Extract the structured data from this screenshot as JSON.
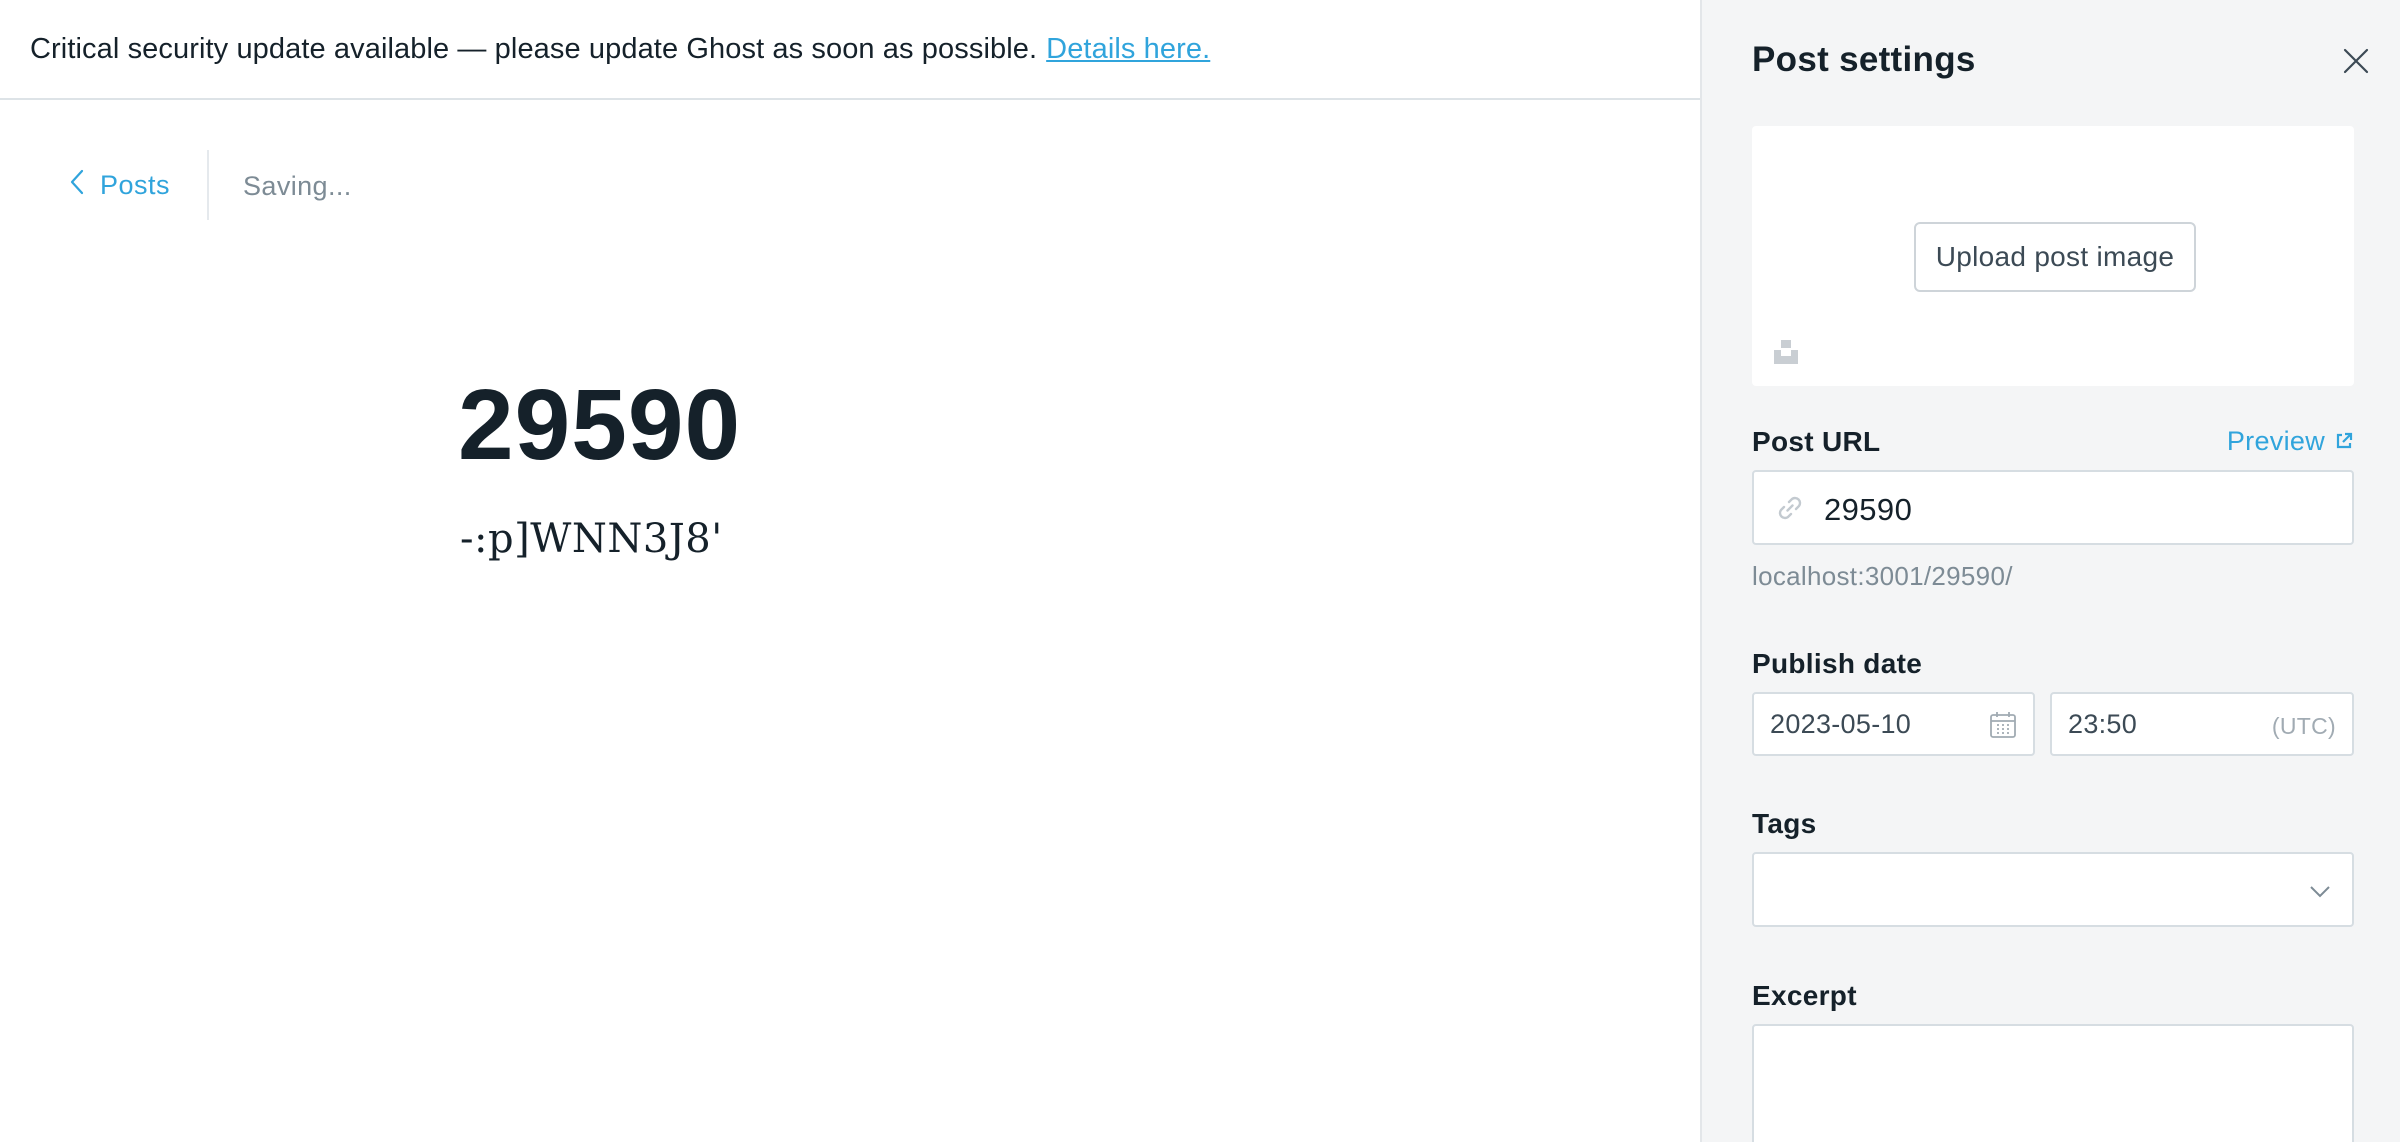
{
  "alert": {
    "message": "Critical security update available — please update Ghost as soon as possible.",
    "link_text": "Details here."
  },
  "editor_nav": {
    "back_label": "Posts",
    "status": "Saving..."
  },
  "post": {
    "title": "29590",
    "body": "-:p]WNN3J8'"
  },
  "settings": {
    "title": "Post settings",
    "upload_label": "Upload post image",
    "post_url": {
      "label": "Post URL",
      "preview_label": "Preview",
      "value": "29590",
      "hint": "localhost:3001/29590/"
    },
    "publish_date": {
      "label": "Publish date",
      "date": "2023-05-10",
      "time": "23:50",
      "timezone": "(UTC)"
    },
    "tags": {
      "label": "Tags",
      "value": ""
    },
    "excerpt": {
      "label": "Excerpt",
      "value": ""
    }
  },
  "colors": {
    "accent": "#30a4dc",
    "text": "#15212a",
    "muted": "#7d8b95",
    "sidebar_bg": "#f4f5f6",
    "border": "#d6dde2"
  },
  "icons": [
    "chevron-left-icon",
    "close-icon",
    "unsplash-icon",
    "link-icon",
    "external-link-icon",
    "calendar-icon",
    "chevron-down-icon"
  ]
}
